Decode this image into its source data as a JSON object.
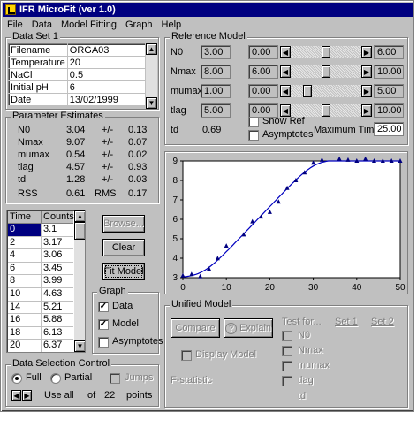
{
  "window": {
    "title": "IFR MicroFit (ver 1.0)"
  },
  "menu": [
    {
      "label": "File"
    },
    {
      "label": "Data"
    },
    {
      "label": "Model Fitting"
    },
    {
      "label": "Graph"
    },
    {
      "label": "Help"
    }
  ],
  "dataset": {
    "label": "Data Set 1",
    "rows": [
      {
        "key": "Filename",
        "value": "ORGA03"
      },
      {
        "key": "Temperature",
        "value": "20"
      },
      {
        "key": "NaCl",
        "value": "0.5"
      },
      {
        "key": "Initial pH",
        "value": "6"
      },
      {
        "key": "Date",
        "value": "13/02/1999"
      }
    ]
  },
  "estimates": {
    "label": "Parameter Estimates",
    "pm": "+/-",
    "rows": [
      {
        "name": "N0",
        "value": "3.04",
        "err": "0.13"
      },
      {
        "name": "Nmax",
        "value": "9.07",
        "err": "0.07"
      },
      {
        "name": "mumax",
        "value": "0.54",
        "err": "0.02"
      },
      {
        "name": "tlag",
        "value": "4.57",
        "err": "0.93"
      },
      {
        "name": "td",
        "value": "1.28",
        "err": "0.03"
      }
    ],
    "rss_label": "RSS",
    "rss": "0.61",
    "rms_label": "RMS",
    "rms": "0.17"
  },
  "table": {
    "headers": [
      "Time",
      "Counts"
    ],
    "rows": [
      [
        "0",
        "3.1"
      ],
      [
        "2",
        "3.17"
      ],
      [
        "4",
        "3.06"
      ],
      [
        "6",
        "3.45"
      ],
      [
        "8",
        "3.99"
      ],
      [
        "10",
        "4.63"
      ],
      [
        "14",
        "5.21"
      ],
      [
        "16",
        "5.88"
      ],
      [
        "18",
        "6.13"
      ],
      [
        "20",
        "6.37"
      ]
    ]
  },
  "buttons": {
    "browse": "Browse...",
    "clear": "Clear",
    "fit": "Fit Model",
    "compare": "Compare",
    "explain": "Explain"
  },
  "graph_opts": {
    "label": "Graph",
    "data": "Data",
    "model": "Model",
    "asym": "Asymptotes",
    "data_checked": "✓",
    "model_checked": "✓"
  },
  "selection": {
    "label": "Data Selection Control",
    "full": "Full",
    "partial": "Partial",
    "jumps": "Jumps",
    "use": "Use all",
    "of": "of",
    "count": "22",
    "points": "points"
  },
  "reference": {
    "label": "Reference Model",
    "rows": [
      {
        "name": "N0",
        "value": "3.00",
        "min": "0.00",
        "max": "6.00",
        "pos": 0.5
      },
      {
        "name": "Nmax",
        "value": "8.00",
        "min": "6.00",
        "max": "10.00",
        "pos": 0.5
      },
      {
        "name": "mumax",
        "value": "1.00",
        "min": "0.00",
        "max": "5.00",
        "pos": 0.2
      },
      {
        "name": "tlag",
        "value": "5.00",
        "min": "0.00",
        "max": "10.00",
        "pos": 0.5
      }
    ],
    "td_label": "td",
    "td": "0.69",
    "show_ref": "Show Ref",
    "asymptotes": "Asymptotes",
    "max_time_label": "Maximum Time",
    "max_time": "25.00"
  },
  "unified": {
    "label": "Unified Model",
    "display": "Display Model",
    "fstat": "F-statistic",
    "test": "Test for...",
    "set1": "Set 1",
    "set2": "Set 2",
    "tests": [
      "N0",
      "Nmax",
      "mumax",
      "tlag"
    ],
    "td": "td"
  },
  "chart_data": {
    "type": "scatter",
    "xlim": [
      0,
      50
    ],
    "ylim": [
      3,
      9
    ],
    "x_ticks": [
      "0",
      "10",
      "20",
      "30",
      "40",
      "50"
    ],
    "y_ticks": [
      "3",
      "4",
      "5",
      "6",
      "7",
      "8",
      "9"
    ],
    "series": [
      {
        "values_x": [
          0,
          2,
          4,
          6,
          8,
          10,
          14,
          16,
          18,
          20,
          22,
          24,
          26,
          28,
          30,
          32,
          36,
          38,
          40,
          42,
          44,
          46,
          48,
          50
        ],
        "values_y": [
          3.1,
          3.17,
          3.06,
          3.45,
          3.99,
          4.63,
          5.21,
          5.88,
          6.13,
          6.37,
          6.9,
          7.6,
          8.0,
          8.4,
          8.9,
          9.05,
          9.1,
          9.05,
          9.0,
          9.1,
          9.0,
          9.0,
          9.0,
          9.0
        ]
      }
    ],
    "model": {
      "N0": 3.04,
      "Nmax": 9.07,
      "mumax": 0.54,
      "tlag": 4.57
    },
    "point_color": "#000080",
    "line_color": "#0000c0"
  }
}
